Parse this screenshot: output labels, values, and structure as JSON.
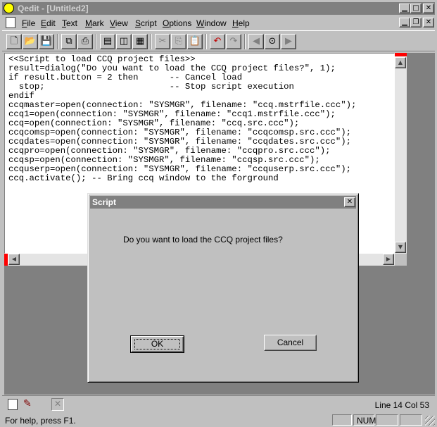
{
  "window": {
    "title": "Qedit - [Untitled2]",
    "app_icon": "qedit-app-icon"
  },
  "menu": [
    {
      "underline": "F",
      "rest": "ile"
    },
    {
      "underline": "E",
      "rest": "dit"
    },
    {
      "underline": "T",
      "rest": "ext"
    },
    {
      "underline": "M",
      "rest": "ark"
    },
    {
      "underline": "V",
      "rest": "iew"
    },
    {
      "underline": "S",
      "rest": "cript"
    },
    {
      "underline": "O",
      "rest": "ptions"
    },
    {
      "underline": "W",
      "rest": "indow"
    },
    {
      "underline": "H",
      "rest": "elp"
    }
  ],
  "toolbar": {
    "icons": [
      "new-file-icon",
      "open-folder-icon",
      "save-icon",
      "copy-window-icon",
      "print-icon",
      "tile-icon",
      "compare-icon",
      "window-list-icon",
      "cut-icon",
      "copy-icon",
      "paste-icon",
      "undo-icon",
      "redo-icon",
      "find-previous-icon",
      "binoculars-icon",
      "find-next-icon"
    ]
  },
  "editor": {
    "code": "<<Script to load CCQ project files>>\nresult=dialog(\"Do you want to load the CCQ project files?\", 1);\nif result.button = 2 then      -- Cancel load\n  stop;                        -- Stop script execution\nendif\nccqmaster=open(connection: \"SYSMGR\", filename: \"ccq.mstrfile.ccc\");\nccq1=open(connection: \"SYSMGR\", filename: \"ccq1.mstrfile.ccc\");\nccq=open(connection: \"SYSMGR\", filename: \"ccq.src.ccc\");\nccqcomsp=open(connection: \"SYSMGR\", filename: \"ccqcomsp.src.ccc\");\nccqdates=open(connection: \"SYSMGR\", filename: \"ccqdates.src.ccc\");\nccqpro=open(connection: \"SYSMGR\", filename: \"ccqpro.src.ccc\");\nccqsp=open(connection: \"SYSMGR\", filename: \"ccqsp.src.ccc\");\nccquserp=open(connection: \"SYSMGR\", filename: \"ccquserp.src.ccc\");\nccq.activate(); -- Bring ccq window to the forground"
  },
  "dialog": {
    "title": "Script",
    "message": "Do you want to load the CCQ project files?",
    "ok_label": "OK",
    "cancel_label": "Cancel"
  },
  "status": {
    "position": "Line 14 Col 53",
    "help": "For help, press F1.",
    "num": "NUM"
  },
  "colors": {
    "titlebar_inactive": "#808080",
    "window_bg": "#c0c0c0",
    "mdi_bg": "#808080",
    "marker_red": "#ff0000"
  }
}
